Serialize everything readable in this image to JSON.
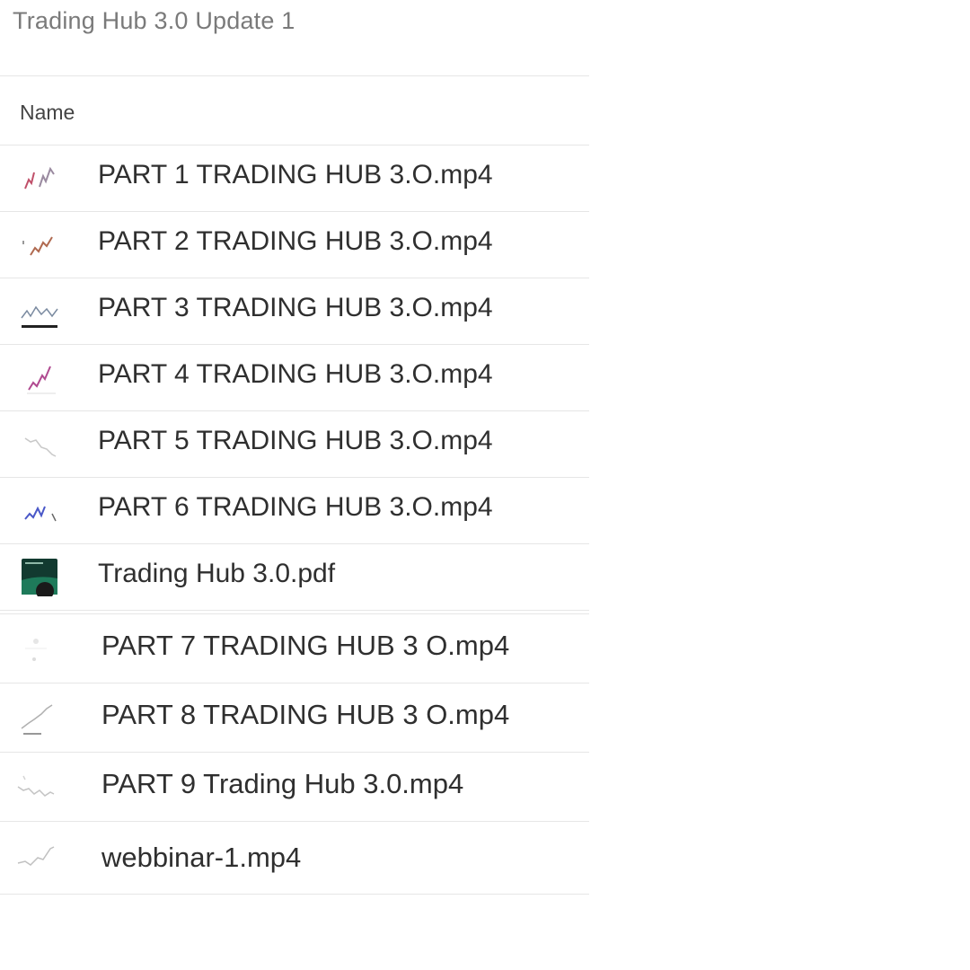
{
  "folder": {
    "title": "Trading Hub 3.0 Update 1"
  },
  "list": {
    "column_name": "Name",
    "files": [
      {
        "name": "PART 1 TRADING HUB 3.O.mp4",
        "thumb_icon": "video-thumbnail-icon",
        "thumb_color": "#c0506a"
      },
      {
        "name": "PART 2 TRADING HUB 3.O.mp4",
        "thumb_icon": "video-thumbnail-icon",
        "thumb_color": "#b06a50"
      },
      {
        "name": "PART 3 TRADING HUB 3.O.mp4",
        "thumb_icon": "video-thumbnail-icon",
        "thumb_color": "#7a8aa0"
      },
      {
        "name": "PART 4 TRADING HUB 3.O.mp4",
        "thumb_icon": "video-thumbnail-icon",
        "thumb_color": "#b04a90"
      },
      {
        "name": "PART 5 TRADING HUB 3.O.mp4",
        "thumb_icon": "video-thumbnail-icon",
        "thumb_color": "#b8b8b8"
      },
      {
        "name": "PART 6 TRADING HUB 3.O.mp4",
        "thumb_icon": "video-thumbnail-icon",
        "thumb_color": "#4a58c8"
      },
      {
        "name": "Trading Hub 3.0.pdf",
        "thumb_icon": "pdf-thumbnail-icon",
        "thumb_color": "#1e7a5a"
      },
      {
        "name": "PART 7 TRADING HUB 3 O.mp4",
        "thumb_icon": "video-thumbnail-icon",
        "thumb_color": "#d8d8d8"
      },
      {
        "name": "PART 8 TRADING HUB 3 O.mp4",
        "thumb_icon": "video-thumbnail-icon",
        "thumb_color": "#a8a8a8"
      },
      {
        "name": "PART 9 Trading Hub 3.0.mp4",
        "thumb_icon": "video-thumbnail-icon",
        "thumb_color": "#c0c0c0"
      },
      {
        "name": "webbinar-1.mp4",
        "thumb_icon": "video-thumbnail-icon",
        "thumb_color": "#b8b8b8"
      }
    ]
  }
}
